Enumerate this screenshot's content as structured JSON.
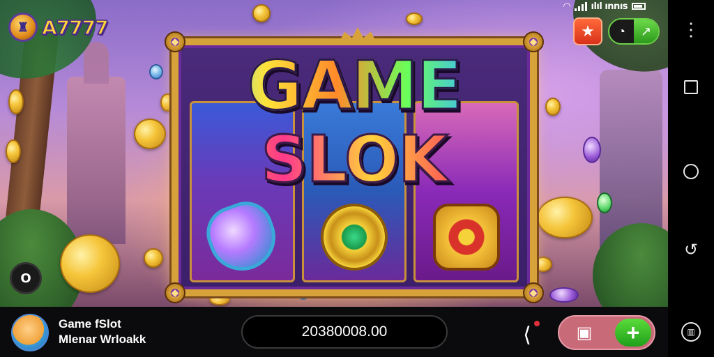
{
  "app": {
    "logo_text": "A7777",
    "status_bar_text": "ılıl ınnıs"
  },
  "top_buttons": {
    "favorite_icon": "star-icon",
    "toggle_left_icon": "speed-icon",
    "toggle_right_icon": "arrow-icon"
  },
  "slot": {
    "title_line1": "GAME",
    "title_line2": "SLOK",
    "reels": [
      {
        "symbol": "diamond-gem"
      },
      {
        "symbol": "emerald-ring"
      },
      {
        "symbol": "ruby-cross"
      }
    ]
  },
  "side_button_label": "O",
  "bottom_bar": {
    "app_title": "Game fSlot",
    "app_subtitle": "Mlenar Wrloakk",
    "balance": "20380008.00",
    "share_icon": "share-icon",
    "ticket_icon": "ticket-icon",
    "plus_label": "+"
  },
  "colors": {
    "frame_gold": "#d8a23a",
    "plus_green": "#2fb82a",
    "action_pink": "#c86a78",
    "star_orange": "#f04a2a"
  }
}
